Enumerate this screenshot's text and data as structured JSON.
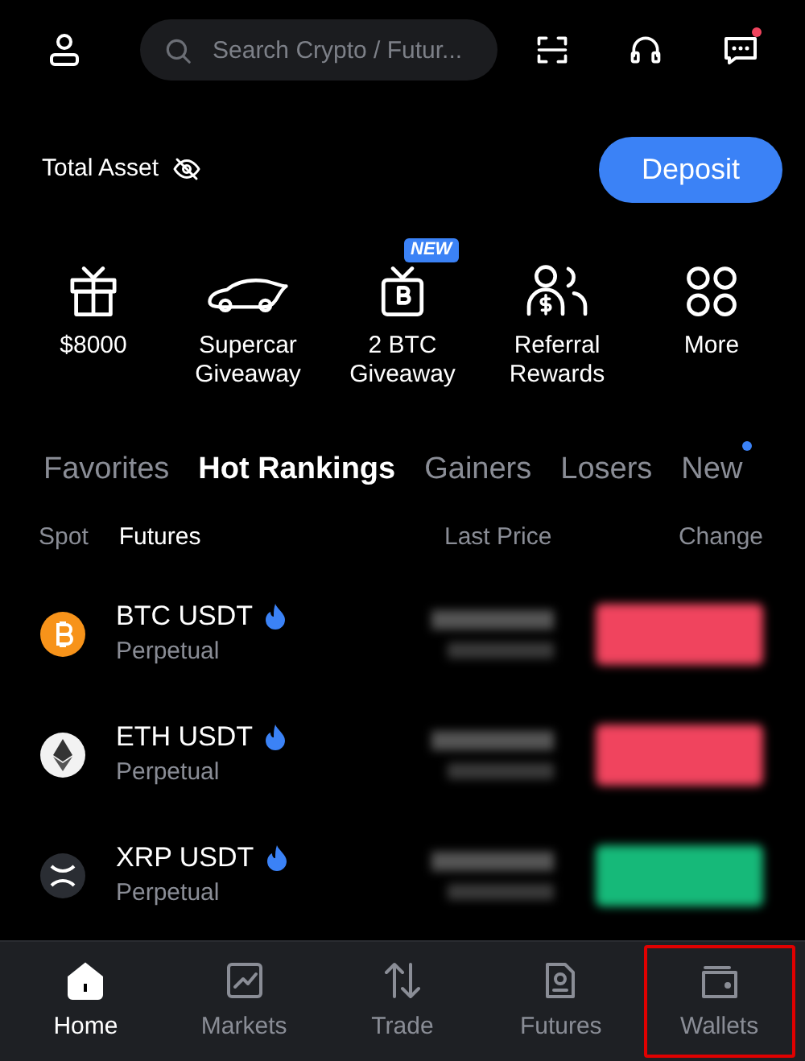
{
  "search": {
    "placeholder": "Search Crypto / Futur..."
  },
  "messages": {
    "unread": true
  },
  "total_asset": {
    "label": "Total Asset"
  },
  "deposit_button": "Deposit",
  "shortcuts": [
    {
      "kind": "gift",
      "label": [
        "$8000"
      ]
    },
    {
      "kind": "car",
      "label": [
        "Supercar",
        "Giveaway"
      ]
    },
    {
      "kind": "btc-gift",
      "label": [
        "2 BTC",
        "Giveaway"
      ],
      "badge": "NEW"
    },
    {
      "kind": "referral",
      "label": [
        "Referral",
        "Rewards"
      ]
    },
    {
      "kind": "more",
      "label": [
        "More"
      ]
    }
  ],
  "ranking_tabs": [
    {
      "label": "Favorites",
      "selected": false
    },
    {
      "label": "Hot Rankings",
      "selected": true
    },
    {
      "label": "Gainers",
      "selected": false
    },
    {
      "label": "Losers",
      "selected": false
    },
    {
      "label": "New",
      "selected": false,
      "dot": true
    }
  ],
  "market_tabs": [
    {
      "label": "Spot",
      "selected": false
    },
    {
      "label": "Futures",
      "selected": true
    }
  ],
  "columns": {
    "last_price": "Last Price",
    "change": "Change"
  },
  "rows": [
    {
      "kind": "btc",
      "pair": "BTC USDT",
      "type": "Perpetual",
      "hot": true,
      "color": "#f0445e"
    },
    {
      "kind": "eth",
      "pair": "ETH USDT",
      "type": "Perpetual",
      "hot": true,
      "color": "#f0445e"
    },
    {
      "kind": "xrp",
      "pair": "XRP USDT",
      "type": "Perpetual",
      "hot": true,
      "color": "#16b979"
    }
  ],
  "nav": [
    {
      "kind": "home",
      "label": "Home",
      "selected": true,
      "highlighted": false
    },
    {
      "kind": "markets",
      "label": "Markets",
      "selected": false,
      "highlighted": false
    },
    {
      "kind": "trade",
      "label": "Trade",
      "selected": false,
      "highlighted": false
    },
    {
      "kind": "futures",
      "label": "Futures",
      "selected": false,
      "highlighted": false
    },
    {
      "kind": "wallets",
      "label": "Wallets",
      "selected": false,
      "highlighted": true
    }
  ]
}
